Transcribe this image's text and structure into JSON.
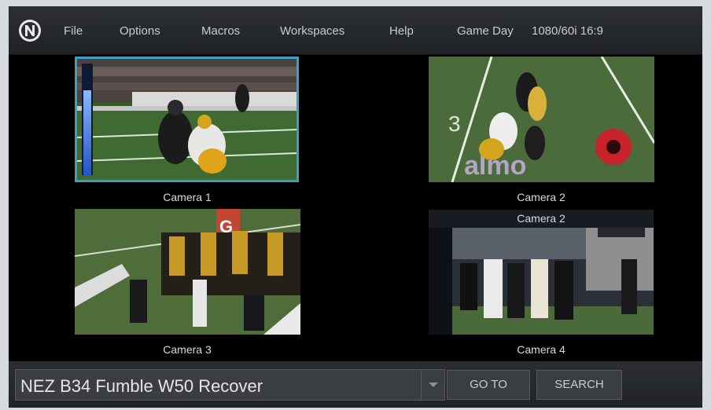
{
  "menubar": {
    "logo_icon": "newtek-logo-icon",
    "items": [
      {
        "label": "File"
      },
      {
        "label": "Options"
      },
      {
        "label": "Macros"
      },
      {
        "label": "Workspaces"
      },
      {
        "label": "Help"
      }
    ],
    "session_name": "Game Day",
    "video_format": "1080/60i 16:9"
  },
  "viewports": [
    {
      "label": "Camera 1",
      "selected": true,
      "audio_level": 0.7
    },
    {
      "label": "Camera 2"
    },
    {
      "label": "Camera 3"
    },
    {
      "label": "Camera 4",
      "top_label": "Camera 2"
    }
  ],
  "bottombar": {
    "marker_value": "NEZ B34 Fumble W50 Recover",
    "goto_label": "GO TO",
    "search_label": "SEARCH"
  },
  "colors": {
    "selected_border": "#3f9ec1",
    "background": "#050607",
    "text": "#c9ccd1"
  }
}
